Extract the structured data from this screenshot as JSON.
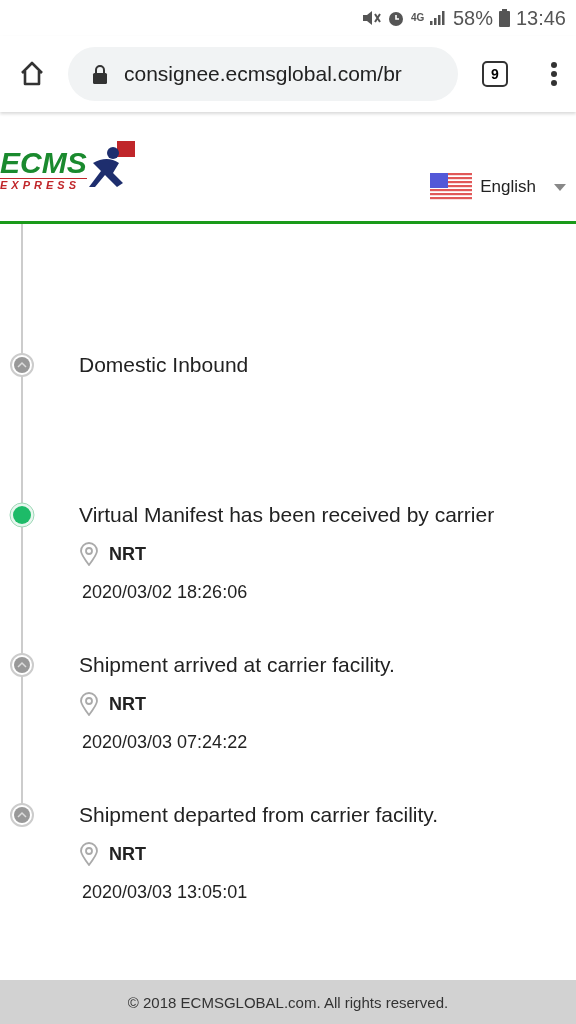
{
  "status_bar": {
    "battery": "58%",
    "time": "13:46",
    "network": "4G"
  },
  "browser": {
    "url": "consignee.ecmsglobal.com/br",
    "tab_count": "9"
  },
  "header": {
    "logo": {
      "name": "ECMS",
      "tagline": "EXPRESS"
    },
    "language": "English"
  },
  "timeline": [
    {
      "kind": "group",
      "title": "Domestic Inbound",
      "current": false
    },
    {
      "kind": "event",
      "title": "Virtual Manifest has been received by carrier",
      "location": "NRT",
      "time": "2020/03/02 18:26:06",
      "current": true
    },
    {
      "kind": "event",
      "title": "Shipment arrived at carrier facility.",
      "location": "NRT",
      "time": "2020/03/03 07:24:22",
      "current": false
    },
    {
      "kind": "event",
      "title": "Shipment departed from carrier facility.",
      "location": "NRT",
      "time": "2020/03/03 13:05:01",
      "current": false
    }
  ],
  "footer": "© 2018 ECMSGLOBAL.com. All rights reserved."
}
